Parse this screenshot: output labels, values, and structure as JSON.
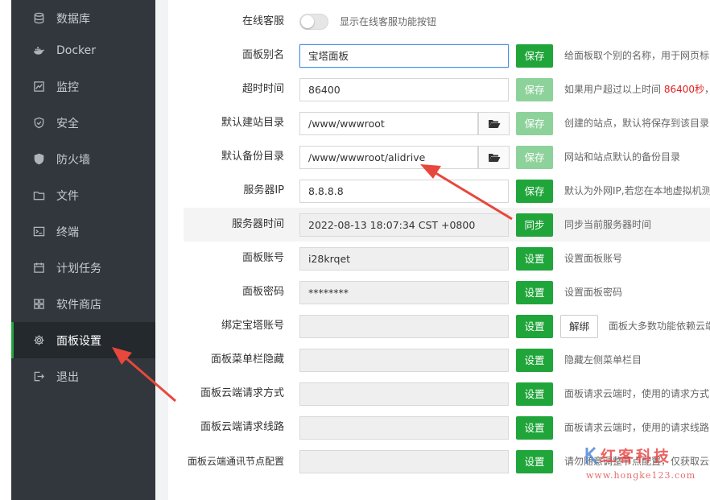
{
  "sidebar": {
    "items": [
      {
        "label": "数据库",
        "icon": "database-icon"
      },
      {
        "label": "Docker",
        "icon": "docker-icon"
      },
      {
        "label": "监控",
        "icon": "monitor-icon"
      },
      {
        "label": "安全",
        "icon": "shield-icon"
      },
      {
        "label": "防火墙",
        "icon": "firewall-icon"
      },
      {
        "label": "文件",
        "icon": "folder-icon"
      },
      {
        "label": "终端",
        "icon": "terminal-icon"
      },
      {
        "label": "计划任务",
        "icon": "calendar-icon"
      },
      {
        "label": "软件商店",
        "icon": "grid-icon"
      },
      {
        "label": "面板设置",
        "icon": "gear-icon",
        "active": true
      },
      {
        "label": "退出",
        "icon": "logout-icon"
      }
    ]
  },
  "settings": {
    "online_service": {
      "label": "在线客服",
      "desc": "显示在线客服功能按钮"
    },
    "panel_alias": {
      "label": "面板别名",
      "value": "宝塔面板",
      "button": "保存",
      "desc": "给面板取个别的名称，用于网页标"
    },
    "timeout": {
      "label": "超时时间",
      "value": "86400",
      "button": "保存",
      "desc_pre": "如果用户超过以上时间 ",
      "desc_red": "86400秒",
      "desc_post": "，"
    },
    "site_dir": {
      "label": "默认建站目录",
      "value": "/www/wwwroot",
      "button": "保存",
      "desc": "创建的站点，默认将保存到该目录"
    },
    "backup_dir": {
      "label": "默认备份目录",
      "value": "/www/wwwroot/alidrive",
      "button": "保存",
      "desc": "网站和站点默认的备份目录"
    },
    "server_ip": {
      "label": "服务器IP",
      "value": "8.8.8.8",
      "button": "保存",
      "desc": "默认为外网IP,若您在本地虚拟机测"
    },
    "server_time": {
      "label": "服务器时间",
      "value": "2022-08-13 18:07:34 CST +0800",
      "button": "同步",
      "desc": "同步当前服务器时间"
    },
    "panel_account": {
      "label": "面板账号",
      "value": "i28krqet",
      "button": "设置",
      "desc": "设置面板账号"
    },
    "panel_password": {
      "label": "面板密码",
      "value": "********",
      "button": "设置",
      "desc": "设置面板密码"
    },
    "bind_account": {
      "label": "绑定宝塔账号",
      "value": "",
      "button": "设置",
      "unbind": "解绑",
      "desc": "面板大多数功能依赖云端"
    },
    "hide_menu": {
      "label": "面板菜单栏隐藏",
      "value": "",
      "button": "设置",
      "desc": "隐藏左侧菜单栏目"
    },
    "cloud_method": {
      "label": "面板云端请求方式",
      "value": "",
      "button": "设置",
      "desc": "面板请求云端时，使用的请求方式"
    },
    "cloud_route": {
      "label": "面板云端请求线路",
      "value": "",
      "button": "设置",
      "desc": "面板请求云端时，使用的请求线路"
    },
    "cloud_node": {
      "label": "面板云端通讯节点配置",
      "value": "",
      "button": "设置",
      "desc": "请勿随意调整节点配置，仅获取云"
    }
  },
  "watermark": {
    "title": "红客科技",
    "url": "www.hongke123.com"
  },
  "colors": {
    "sidebar_bg": "#31373d",
    "active_bg": "#24292e",
    "accent": "#20a53a",
    "accent_light": "#8ed29b",
    "arrow": "#e8473c"
  }
}
